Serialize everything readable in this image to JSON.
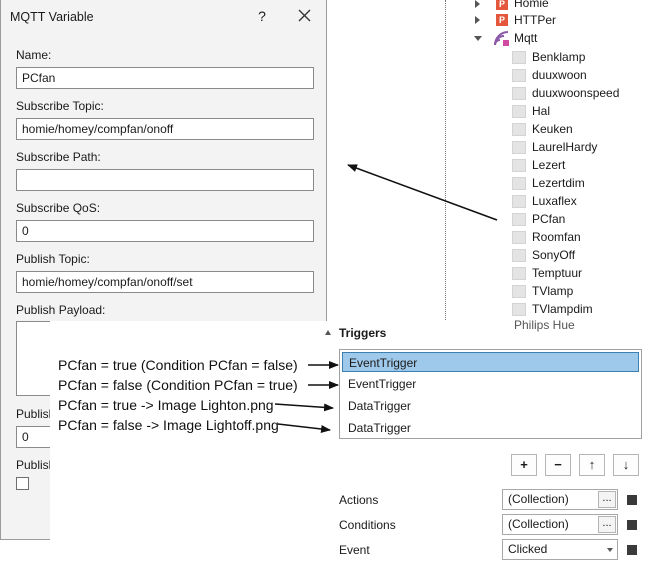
{
  "dialog": {
    "title": "MQTT Variable",
    "help_glyph": "?",
    "fields": [
      {
        "label": "Name:",
        "value": "PCfan"
      },
      {
        "label": "Subscribe Topic:",
        "value": "homie/homey/compfan/onoff"
      },
      {
        "label": "Subscribe Path:",
        "value": ""
      },
      {
        "label": "Subscribe QoS:",
        "value": "0"
      },
      {
        "label": "Publish Topic:",
        "value": "homie/homey/compfan/onoff/set"
      }
    ],
    "payload_label": "Publish Payload:",
    "publish_qos_label": "Publish",
    "publish_qos_value": "0",
    "publish_retain_label": "Publish"
  },
  "tree": {
    "parents": [
      "Homie",
      "HTTPer"
    ],
    "parent_icon_glyph": "P",
    "expanded": "Mqtt",
    "children": [
      "Benklamp",
      "duuxwoon",
      "duuxwoonspeed",
      "Hal",
      "Keuken",
      "LaurelHardy",
      "Lezert",
      "Lezertdim",
      "Luxaflex",
      "PCfan",
      "Roomfan",
      "SonyOff",
      "Temptuur",
      "TVlamp",
      "TVlampdim"
    ],
    "partial_next": "Philips Hue"
  },
  "triggers": {
    "header": "Triggers",
    "items": [
      {
        "label": "EventTrigger",
        "selected": true
      },
      {
        "label": "EventTrigger",
        "selected": false
      },
      {
        "label": "DataTrigger",
        "selected": false
      },
      {
        "label": "DataTrigger",
        "selected": false
      }
    ],
    "toolbar": {
      "add": "+",
      "remove": "−",
      "up": "↑",
      "down": "↓"
    },
    "properties": [
      {
        "label": "Actions",
        "value": "(Collection)",
        "kind": "collection"
      },
      {
        "label": "Conditions",
        "value": "(Collection)",
        "kind": "collection"
      },
      {
        "label": "Event",
        "value": "Clicked",
        "kind": "dropdown"
      }
    ],
    "ellipsis": "..."
  },
  "annotations": [
    "PCfan = true (Condition PCfan = false)",
    "PCfan = false (Condition PCfan = true)",
    "PCfan = true -> Image Lighton.png",
    "PCfan = false -> Image Lightoff.png"
  ],
  "colors": {
    "selection": "#9fc9ea",
    "selection_border": "#3c7fb1",
    "parent_icon": "#e4573d",
    "mqtt_icon": "#8a5aa8"
  }
}
